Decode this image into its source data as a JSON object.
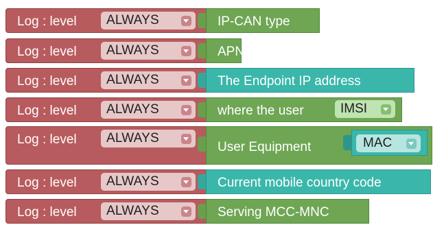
{
  "colors": {
    "log_block": "#b85b5e",
    "level_dropdown": "#e7c8c9",
    "text_block_green": "#6ea654",
    "text_block_teal": "#3ab7aa"
  },
  "log_label": "Log : level",
  "level_value": "ALWAYS",
  "rows": [
    {
      "text": "IP-CAN type"
    },
    {
      "text": "APN"
    },
    {
      "text": "The Endpoint IP address"
    },
    {
      "text": "where the user",
      "dropdown": "IMSI"
    },
    {
      "text": "User Equipment",
      "dropdown": "MAC"
    },
    {
      "text": "Current mobile country code"
    },
    {
      "text": "Serving MCC-MNC"
    }
  ]
}
